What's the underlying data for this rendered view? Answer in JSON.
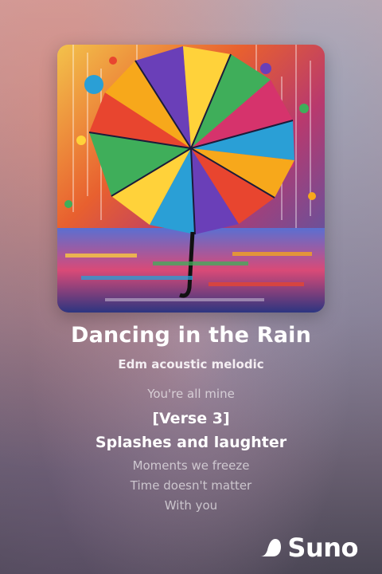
{
  "song": {
    "title": "Dancing in the Rain",
    "style": "Edm acoustic melodic"
  },
  "lyrics": [
    {
      "text": "You're all mine",
      "active": false
    },
    {
      "text": "[Verse 3]",
      "active": true
    },
    {
      "text": "Splashes and laughter",
      "active": true
    },
    {
      "text": "Moments we freeze",
      "active": false
    },
    {
      "text": "Time doesn't matter",
      "active": false
    },
    {
      "text": "With you",
      "active": false
    }
  ],
  "artwork": {
    "subject": "umbrella-rain-painting",
    "colors": [
      "#e8452f",
      "#f7a81b",
      "#ffd23a",
      "#3fae5a",
      "#2a9fd6",
      "#6a3fb8",
      "#d6336c"
    ]
  },
  "brand": {
    "name": "Suno"
  }
}
